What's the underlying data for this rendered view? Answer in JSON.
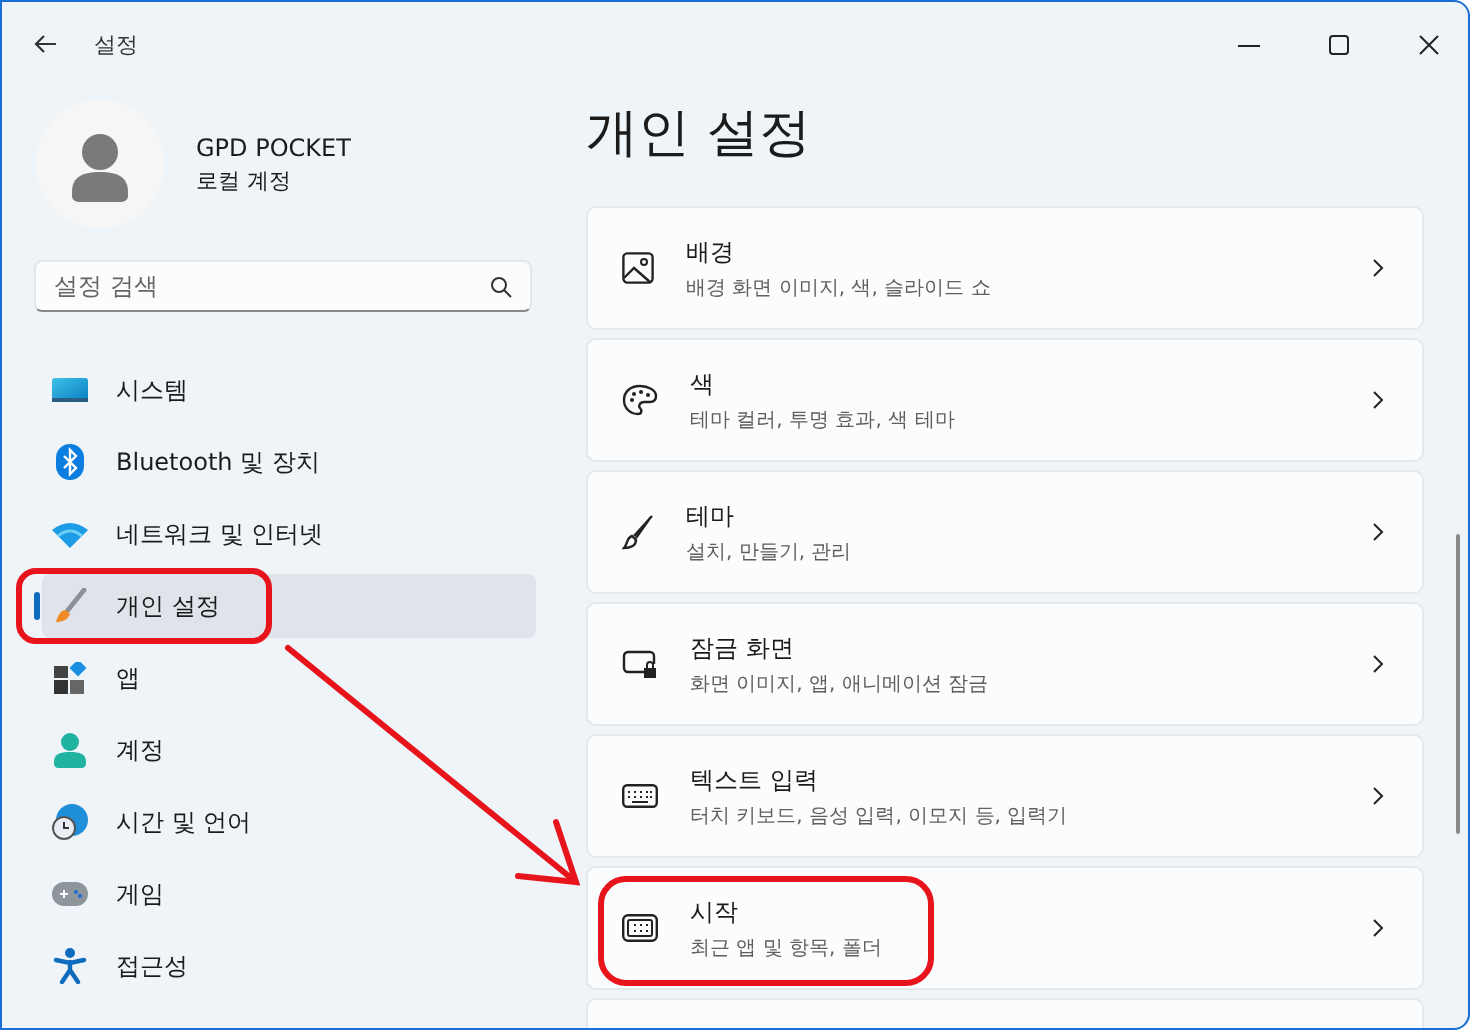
{
  "window": {
    "title": "설정"
  },
  "account": {
    "name": "GPD POCKET",
    "type": "로컬 계정"
  },
  "search": {
    "placeholder": "설정 검색"
  },
  "sidebar": {
    "items": [
      {
        "label": "시스템",
        "selected": false,
        "highlighted": false
      },
      {
        "label": "Bluetooth 및 장치",
        "selected": false,
        "highlighted": false
      },
      {
        "label": "네트워크 및 인터넷",
        "selected": false,
        "highlighted": false
      },
      {
        "label": "개인 설정",
        "selected": true,
        "highlighted": true
      },
      {
        "label": "앱",
        "selected": false,
        "highlighted": false
      },
      {
        "label": "계정",
        "selected": false,
        "highlighted": false
      },
      {
        "label": "시간 및 언어",
        "selected": false,
        "highlighted": false
      },
      {
        "label": "게임",
        "selected": false,
        "highlighted": false
      },
      {
        "label": "접근성",
        "selected": false,
        "highlighted": false
      }
    ]
  },
  "page": {
    "title": "개인 설정",
    "cards": [
      {
        "title": "배경",
        "subtitle": "배경 화면 이미지, 색, 슬라이드 쇼",
        "highlighted": false
      },
      {
        "title": "색",
        "subtitle": "테마 컬러, 투명 효과, 색 테마",
        "highlighted": false
      },
      {
        "title": "테마",
        "subtitle": "설치, 만들기, 관리",
        "highlighted": false
      },
      {
        "title": "잠금 화면",
        "subtitle": "화면 이미지, 앱, 애니메이션 잠금",
        "highlighted": false
      },
      {
        "title": "텍스트 입력",
        "subtitle": "터치 키보드, 음성 입력, 이모지 등, 입력기",
        "highlighted": false
      },
      {
        "title": "시작",
        "subtitle": "최근 앱 및 항목, 폴더",
        "highlighted": true
      }
    ]
  },
  "annotation_arrow": true
}
